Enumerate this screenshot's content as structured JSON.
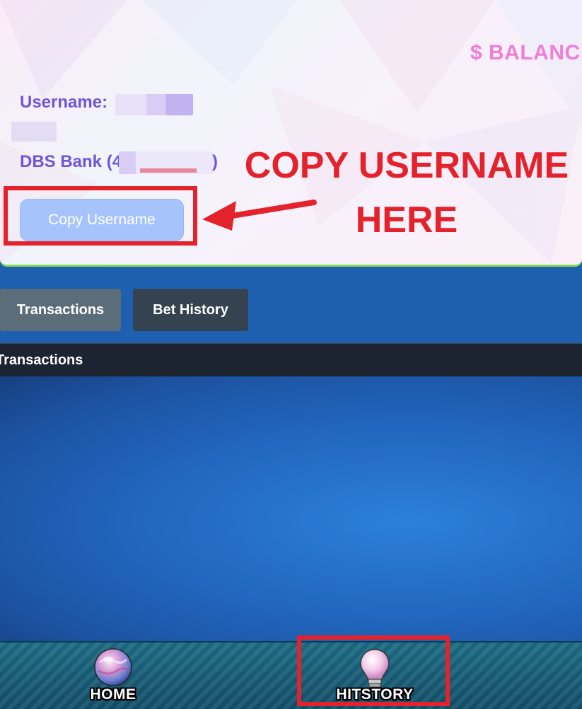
{
  "card": {
    "balance_label": "$ BALANC",
    "username_label": "Username:",
    "bank_prefix": "DBS Bank (4",
    "bank_suffix": ")",
    "copy_button": "Copy Username"
  },
  "annotation": {
    "line1": "COPY USERNAME",
    "line2": "HERE"
  },
  "tabs": {
    "transactions": "Transactions",
    "bet_history": "Bet History"
  },
  "section": {
    "title": "Transactions"
  },
  "bottom_nav": {
    "home": "HOME",
    "history": "HITSTORY"
  },
  "colors": {
    "highlight_red": "#e3222b",
    "label_purple": "#6f55d9",
    "balance_pink": "#f07ed8",
    "button_blue": "#a6c3fb",
    "card_border_green": "#7ed957"
  },
  "icons": [
    "arrow-left-icon",
    "globe-icon",
    "lightbulb-icon"
  ]
}
